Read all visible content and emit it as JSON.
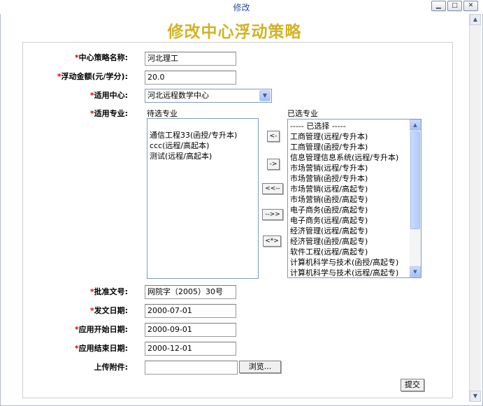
{
  "window": {
    "title": "修改",
    "minimize_icon": "minimize-icon",
    "maximize_icon": "maximize-icon",
    "close_icon": "close-icon"
  },
  "page_title": "修改中心浮动策略",
  "form": {
    "policy_name": {
      "required_mark": "*",
      "label": "中心策略名称:",
      "value": "河北理工"
    },
    "float_amount": {
      "required_mark": "*",
      "label": "浮动金额(元/学分):",
      "value": "20.0"
    },
    "center": {
      "required_mark": "*",
      "label": "适用中心:",
      "selected": "河北远程数学中心"
    },
    "majors": {
      "required_mark": "*",
      "label": "适用专业:",
      "available_caption": "待选专业",
      "available": [
        "通信工程33(函授/专升本)",
        "ccc(远程/高起本)",
        "测试(远程/高起本)"
      ],
      "selected_caption": "已选专业",
      "selected": [
        "----- 已选择 -----",
        "工商管理(远程/专升本)",
        "工商管理(函授/专升本)",
        "信息管理信息系统(远程/专升本)",
        "市场营销(远程/专升本)",
        "市场营销(函授/专升本)",
        "市场营销(远程/高起专)",
        "市场营销(函授/高起专)",
        "电子商务(函授/高起专)",
        "电子商务(远程/高起专)",
        "经济管理(远程/高起专)",
        "经济管理(函授/高起专)",
        "软件工程(远程/高起专)",
        "计算机科学与技术(函授/高起专)",
        "计算机科学与技术(远程/高起专)"
      ],
      "buttons": {
        "move_left": "<-",
        "move_right": "->",
        "move_all_left": "<<--",
        "move_all_right": "-->>",
        "swap": "<*>"
      }
    },
    "approval_no": {
      "required_mark": "*",
      "label": "批准文号:",
      "value": "网院字（2005）30号"
    },
    "issue_date": {
      "required_mark": "*",
      "label": "发文日期:",
      "value": "2000-07-01"
    },
    "start_date": {
      "required_mark": "*",
      "label": "应用开始日期:",
      "value": "2000-09-01"
    },
    "end_date": {
      "required_mark": "*",
      "label": "应用结束日期:",
      "value": "2000-12-01"
    },
    "attachment": {
      "label": "上传附件:",
      "value": "",
      "browse_label": "浏览..."
    },
    "submit_label": "提交"
  }
}
